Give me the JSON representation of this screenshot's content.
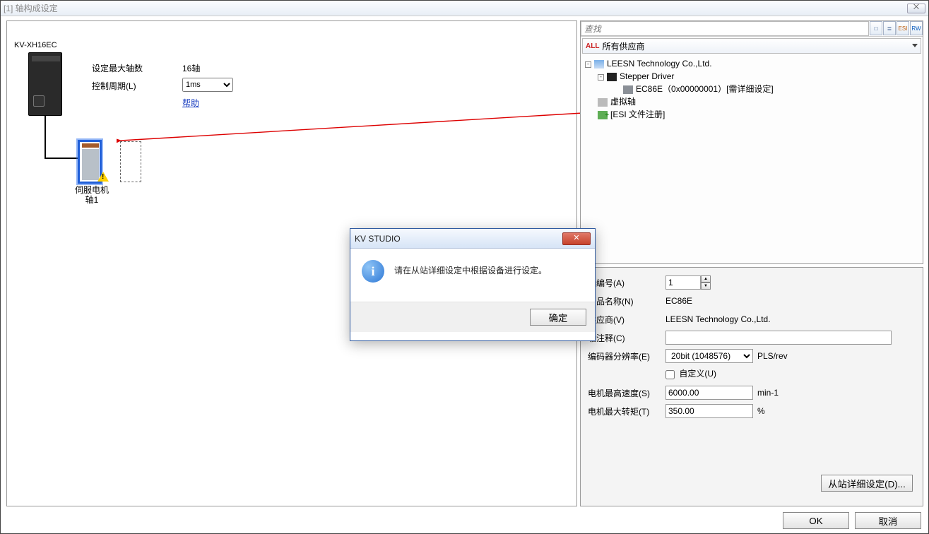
{
  "window": {
    "title": "[1] 轴构成设定",
    "close_x": "⨉"
  },
  "left": {
    "device_label": "KV-XH16EC",
    "max_axes_label": "设定最大轴数",
    "max_axes_value": "16轴",
    "cycle_label": "控制周期(L)",
    "cycle_value": "1ms",
    "help_label": "帮助",
    "axis_caption_line1": "伺服电机",
    "axis_caption_line2": "轴1"
  },
  "search": {
    "placeholder": "查找"
  },
  "toolbar_icons": {
    "b1": "□",
    "b2": "≣",
    "b3": "ESI",
    "b4": "RW"
  },
  "vendor_filter": {
    "all_tag": "ALL",
    "label": "所有供应商"
  },
  "tree": {
    "n0": "LEESN Technology Co.,Ltd.",
    "n1": "Stepper Driver",
    "n2": "EC86E（0x00000001）[需详细设定]",
    "n3": "虚拟轴",
    "n4": "[ESI 文件注册]"
  },
  "props": {
    "axis_no_label": "轴编号(A)",
    "axis_no_value": "1",
    "product_label": "产品名称(N)",
    "product_value": "EC86E",
    "vendor_label": "供应商(V)",
    "vendor_value": "LEESN Technology Co.,Ltd.",
    "comment_label": "轴注释(C)",
    "comment_value": "",
    "encoder_label": "编码器分辨率(E)",
    "encoder_value": "20bit (1048576)",
    "encoder_unit": "PLS/rev",
    "custom_label": "自定义(U)",
    "maxspeed_label": "电机最高速度(S)",
    "maxspeed_value": "6000.00",
    "maxspeed_unit": "min-1",
    "maxtorque_label": "电机最大转矩(T)",
    "maxtorque_value": "350.00",
    "maxtorque_unit": "%",
    "detail_button": "从站详细设定(D)..."
  },
  "footer": {
    "ok": "OK",
    "cancel": "取消"
  },
  "dialog": {
    "title": "KV STUDIO",
    "message": "请在从站详细设定中根据设备进行设定。",
    "ok": "确定",
    "close_x": "✕"
  }
}
